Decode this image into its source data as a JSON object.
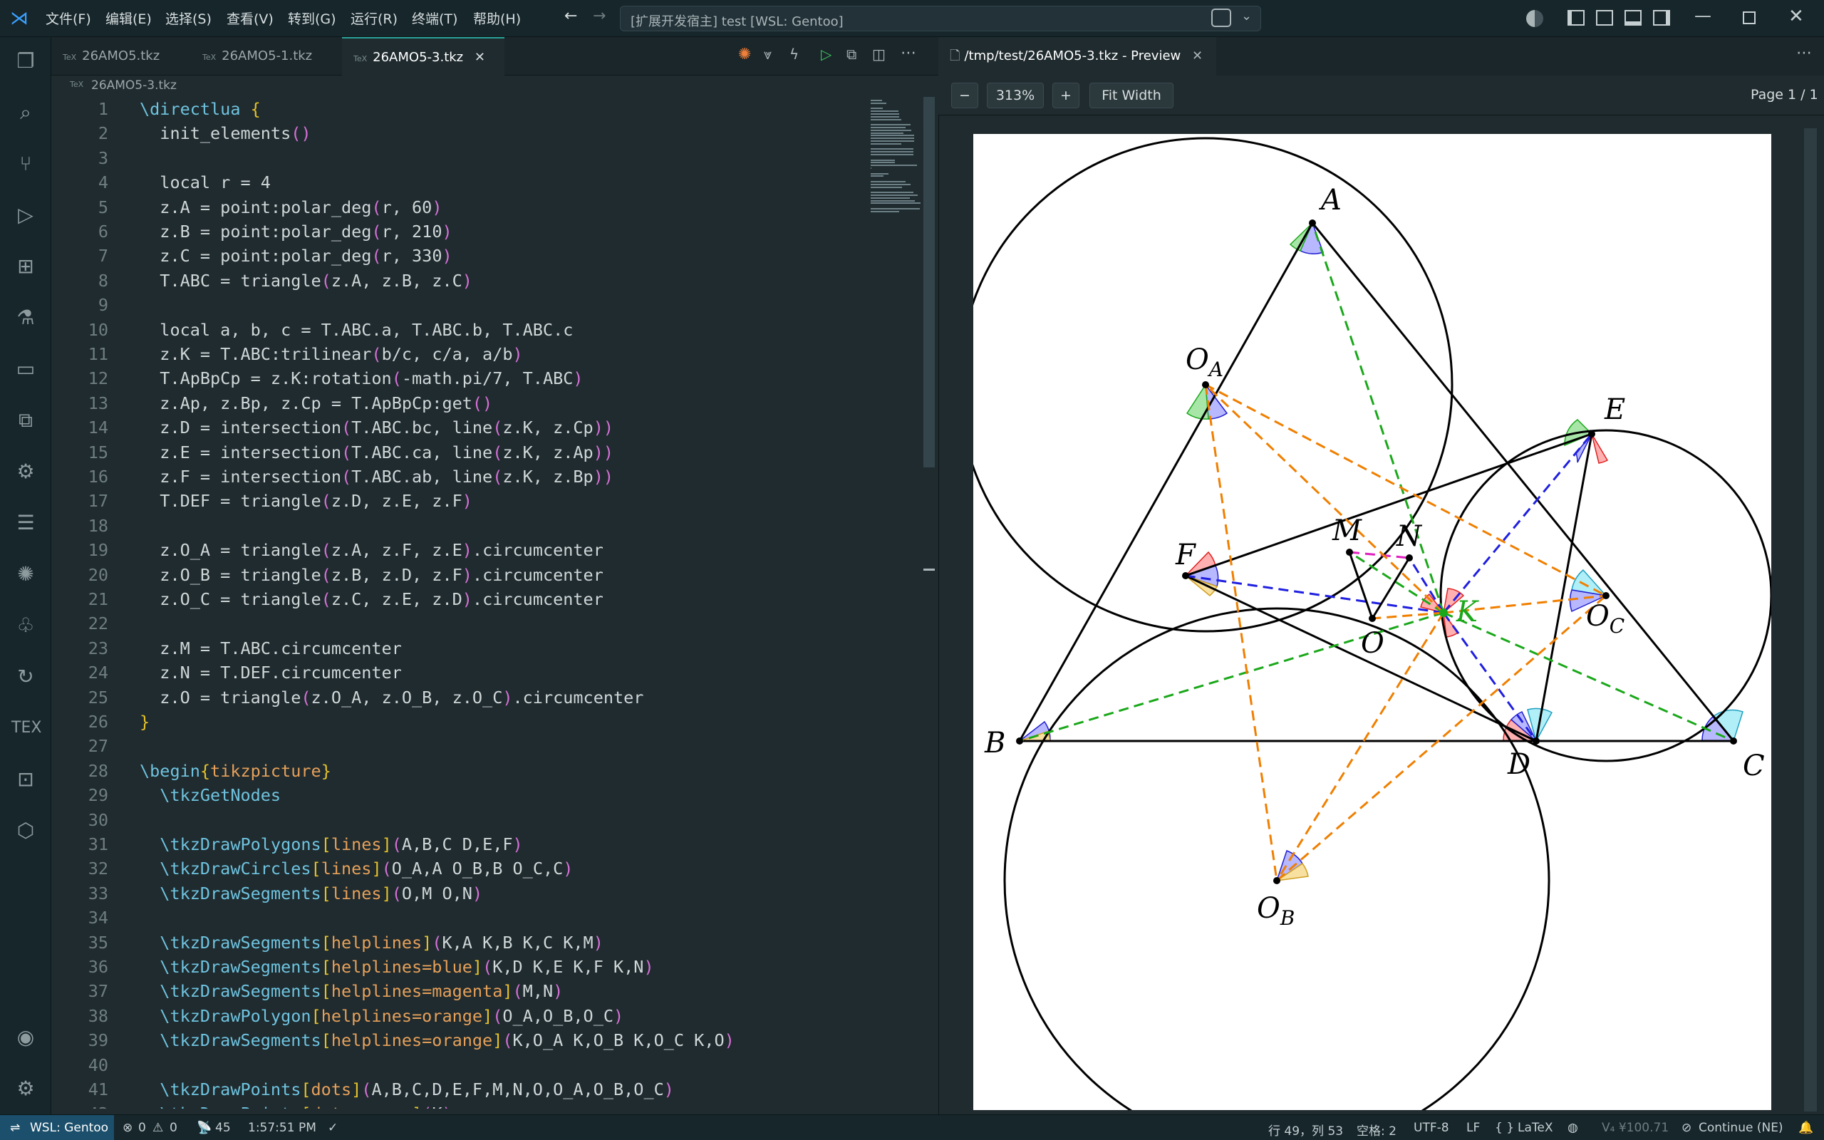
{
  "titlebar": {
    "menu": [
      "文件(F)",
      "编辑(E)",
      "选择(S)",
      "查看(V)",
      "转到(G)",
      "运行(R)",
      "终端(T)",
      "帮助(H)"
    ],
    "search_text": "[扩展开发宿主] test [WSL: Gentoo]"
  },
  "activity": [
    "files-icon",
    "search-icon",
    "source-control-icon",
    "run-debug-icon",
    "extensions-icon",
    "testing-icon",
    "folder-icon",
    "remote-explorer-icon",
    "remote-settings-icon",
    "outline-icon",
    "spark-icon",
    "tree-icon",
    "loop-icon",
    "tex-icon",
    "remote-window-icon",
    "package-icon",
    "account-icon",
    "gear-icon"
  ],
  "tabs": [
    {
      "label": "26AMO5.tkz",
      "tag": "TeX"
    },
    {
      "label": "26AMO5-1.tkz",
      "tag": "TeX"
    },
    {
      "label": "26AMO5-3.tkz",
      "tag": "TeX"
    }
  ],
  "breadcrumb": {
    "tag": "TeX",
    "label": "26AMO5-3.tkz"
  },
  "code": [
    "\\directlua {",
    "  init_elements()",
    "",
    "  local r = 4",
    "  z.A = point:polar_deg(r, 60)",
    "  z.B = point:polar_deg(r, 210)",
    "  z.C = point:polar_deg(r, 330)",
    "  T.ABC = triangle(z.A, z.B, z.C)",
    "",
    "  local a, b, c = T.ABC.a, T.ABC.b, T.ABC.c",
    "  z.K = T.ABC:trilinear(b/c, c/a, a/b)",
    "  T.ApBpCp = z.K:rotation(-math.pi/7, T.ABC)",
    "  z.Ap, z.Bp, z.Cp = T.ApBpCp:get()",
    "  z.D = intersection(T.ABC.bc, line(z.K, z.Cp))",
    "  z.E = intersection(T.ABC.ca, line(z.K, z.Ap))",
    "  z.F = intersection(T.ABC.ab, line(z.K, z.Bp))",
    "  T.DEF = triangle(z.D, z.E, z.F)",
    "",
    "  z.O_A = triangle(z.A, z.F, z.E).circumcenter",
    "  z.O_B = triangle(z.B, z.D, z.F).circumcenter",
    "  z.O_C = triangle(z.C, z.E, z.D).circumcenter",
    "",
    "  z.M = T.ABC.circumcenter",
    "  z.N = T.DEF.circumcenter",
    "  z.O = triangle(z.O_A, z.O_B, z.O_C).circumcenter",
    "}",
    "",
    "\\begin{tikzpicture}",
    "  \\tkzGetNodes",
    "",
    "  \\tkzDrawPolygons[lines](A,B,C D,E,F)",
    "  \\tkzDrawCircles[lines](O_A,A O_B,B O_C,C)",
    "  \\tkzDrawSegments[lines](O,M O,N)",
    "",
    "  \\tkzDrawSegments[helplines](K,A K,B K,C K,M)",
    "  \\tkzDrawSegments[helplines=blue](K,D K,E K,F K,N)",
    "  \\tkzDrawSegments[helplines=magenta](M,N)",
    "  \\tkzDrawPolygon[helplines=orange](O_A,O_B,O_C)",
    "  \\tkzDrawSegments[helplines=orange](K,O_A K,O_B K,O_C K,O)",
    "",
    "  \\tkzDrawPoints[dots](A,B,C,D,E,F,M,N,O,O_A,O_B,O_C)",
    "  \\tkzDrawPoints[dots=green](K)"
  ],
  "preview": {
    "tab_label": "/tmp/test/26AMO5-3.tkz - Preview",
    "zoom_out": "−",
    "zoom": "313%",
    "zoom_in": "+",
    "fit": "Fit Width",
    "page": "Page 1 / 1"
  },
  "figure_labels": {
    "A": "A",
    "B": "B",
    "C": "C",
    "D": "D",
    "E": "E",
    "F": "F",
    "M": "M",
    "N": "N",
    "O": "O",
    "K": "K",
    "OA": "O",
    "OA_sub": "A",
    "OB": "O",
    "OB_sub": "B",
    "OC": "O",
    "OC_sub": "C"
  },
  "status": {
    "remote": "WSL: Gentoo",
    "errors": "0",
    "warnings": "0",
    "ports": "45",
    "time": "1:57:51 PM",
    "position": "行 49，列 53",
    "spaces": "空格: 2",
    "encoding": "UTF-8",
    "eol": "LF",
    "language": "LaTeX",
    "price": "V₄ ¥100.71",
    "continue": "Continue (NE)"
  },
  "colors": {
    "accent": "#2aa198",
    "green": "#1aa81a",
    "blue": "#1f1fe0",
    "orange": "#f07f00",
    "magenta": "#e020c0"
  }
}
